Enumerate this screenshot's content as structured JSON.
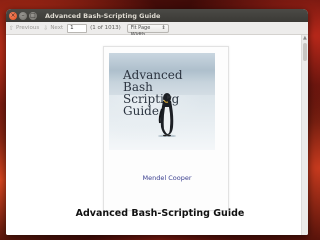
{
  "window": {
    "title": "Advanced Bash-Scripting Guide"
  },
  "toolbar": {
    "previous_label": "Previous",
    "next_label": "Next",
    "page_value": "1",
    "page_of": "(1 of 1013)",
    "zoom_value": "Fit Page Width"
  },
  "document": {
    "cover_title_lines": [
      "Advanced",
      "Bash",
      "Scripting",
      "Guide"
    ],
    "author": "Mendel Cooper"
  },
  "caption": "Advanced Bash-Scripting Guide",
  "colors": {
    "titlebar": "#3b3a36",
    "close_button": "#df4b16",
    "author_text": "#3a3f8f"
  }
}
